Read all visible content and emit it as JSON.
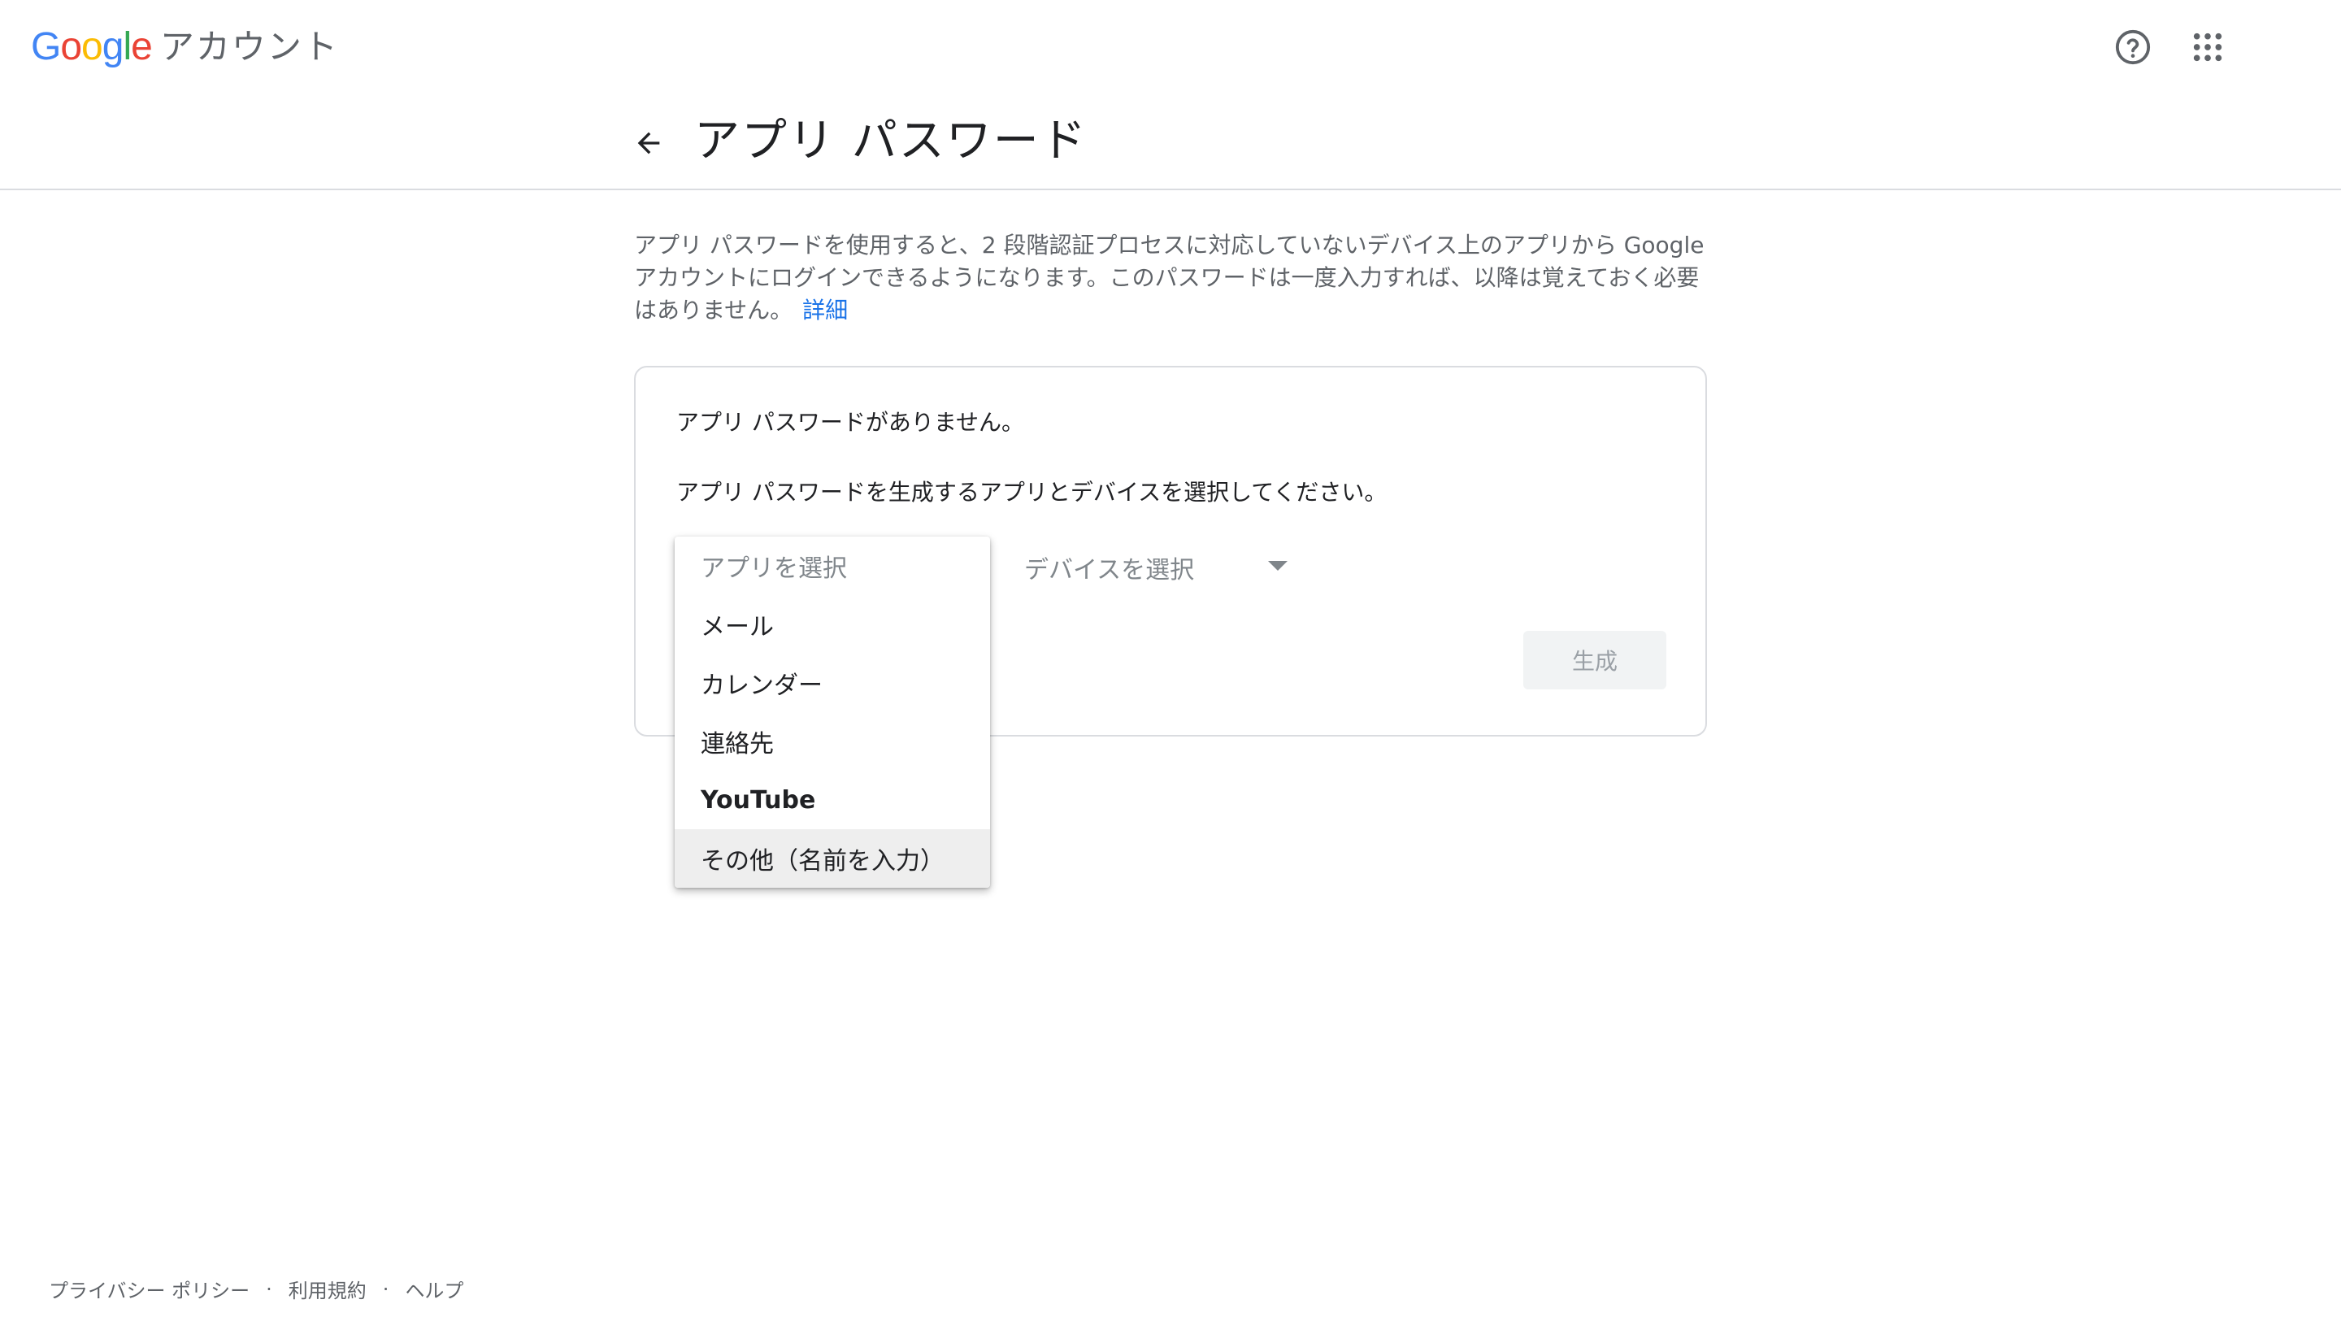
{
  "header": {
    "logo_letters": [
      {
        "char": "G",
        "color": "#4285F4"
      },
      {
        "char": "o",
        "color": "#EA4335"
      },
      {
        "char": "o",
        "color": "#FBBC05"
      },
      {
        "char": "g",
        "color": "#4285F4"
      },
      {
        "char": "l",
        "color": "#34A853"
      },
      {
        "char": "e",
        "color": "#EA4335"
      }
    ],
    "product_name": "アカウント",
    "help_icon": "help-circle-icon",
    "apps_icon": "apps-grid-icon"
  },
  "page": {
    "title": "アプリ パスワード",
    "back_icon": "arrow-back-icon"
  },
  "description": {
    "text": "アプリ パスワードを使用すると、2 段階認証プロセスに対応していないデバイス上のアプリから Google アカウントにログインできるようになります。このパスワードは一度入力すれば、以降は覚えておく必要はありません。",
    "link_label": "詳細",
    "link_color": "#1a73e8"
  },
  "card": {
    "no_passwords": "アプリ パスワードがありません。",
    "instruction": "アプリ パスワードを生成するアプリとデバイスを選択してください。",
    "device_select_label": "デバイスを選択",
    "generate_label": "生成"
  },
  "app_dropdown": {
    "placeholder": "アプリを選択",
    "options": [
      "メール",
      "カレンダー",
      "連絡先",
      "YouTube",
      "その他（名前を入力）"
    ]
  },
  "footer": {
    "privacy": "プライバシー ポリシー",
    "terms": "利用規約",
    "help": "ヘルプ",
    "separator": "·"
  }
}
